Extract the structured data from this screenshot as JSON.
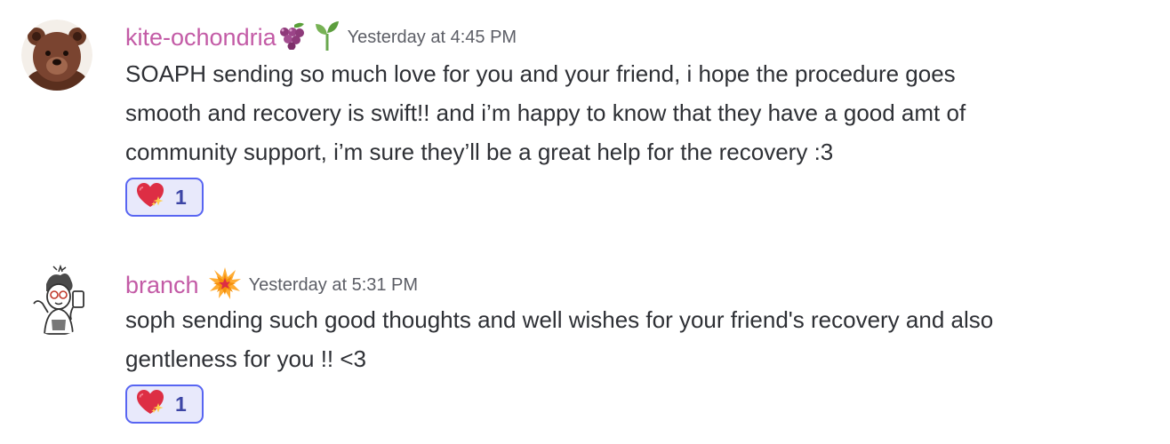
{
  "messages": [
    {
      "username": "kite-ochondria",
      "badges": [
        "grapes-icon",
        "seedling-icon"
      ],
      "timestamp": "Yesterday at 4:45 PM",
      "lines": [
        "SOAPH sending so much love for you and your friend, i hope the procedure goes",
        "smooth and recovery is swift!! and i’m happy to know that they have a good amt of",
        "community support, i’m sure they’ll be a great help for the recovery :3"
      ],
      "reaction": {
        "icon": "sparkling-heart-icon",
        "count": "1"
      }
    },
    {
      "username": "branch",
      "badges": [
        "collision-icon"
      ],
      "timestamp": "Yesterday at 5:31 PM",
      "lines": [
        "soph sending such good thoughts and well wishes for your friend's recovery and also",
        "gentleness for you !! <3"
      ],
      "reaction": {
        "icon": "sparkling-heart-icon",
        "count": "1"
      }
    }
  ],
  "colors": {
    "username": "#c35ba6",
    "reaction_border": "#5865f2",
    "reaction_bg": "#e8e9fb"
  }
}
